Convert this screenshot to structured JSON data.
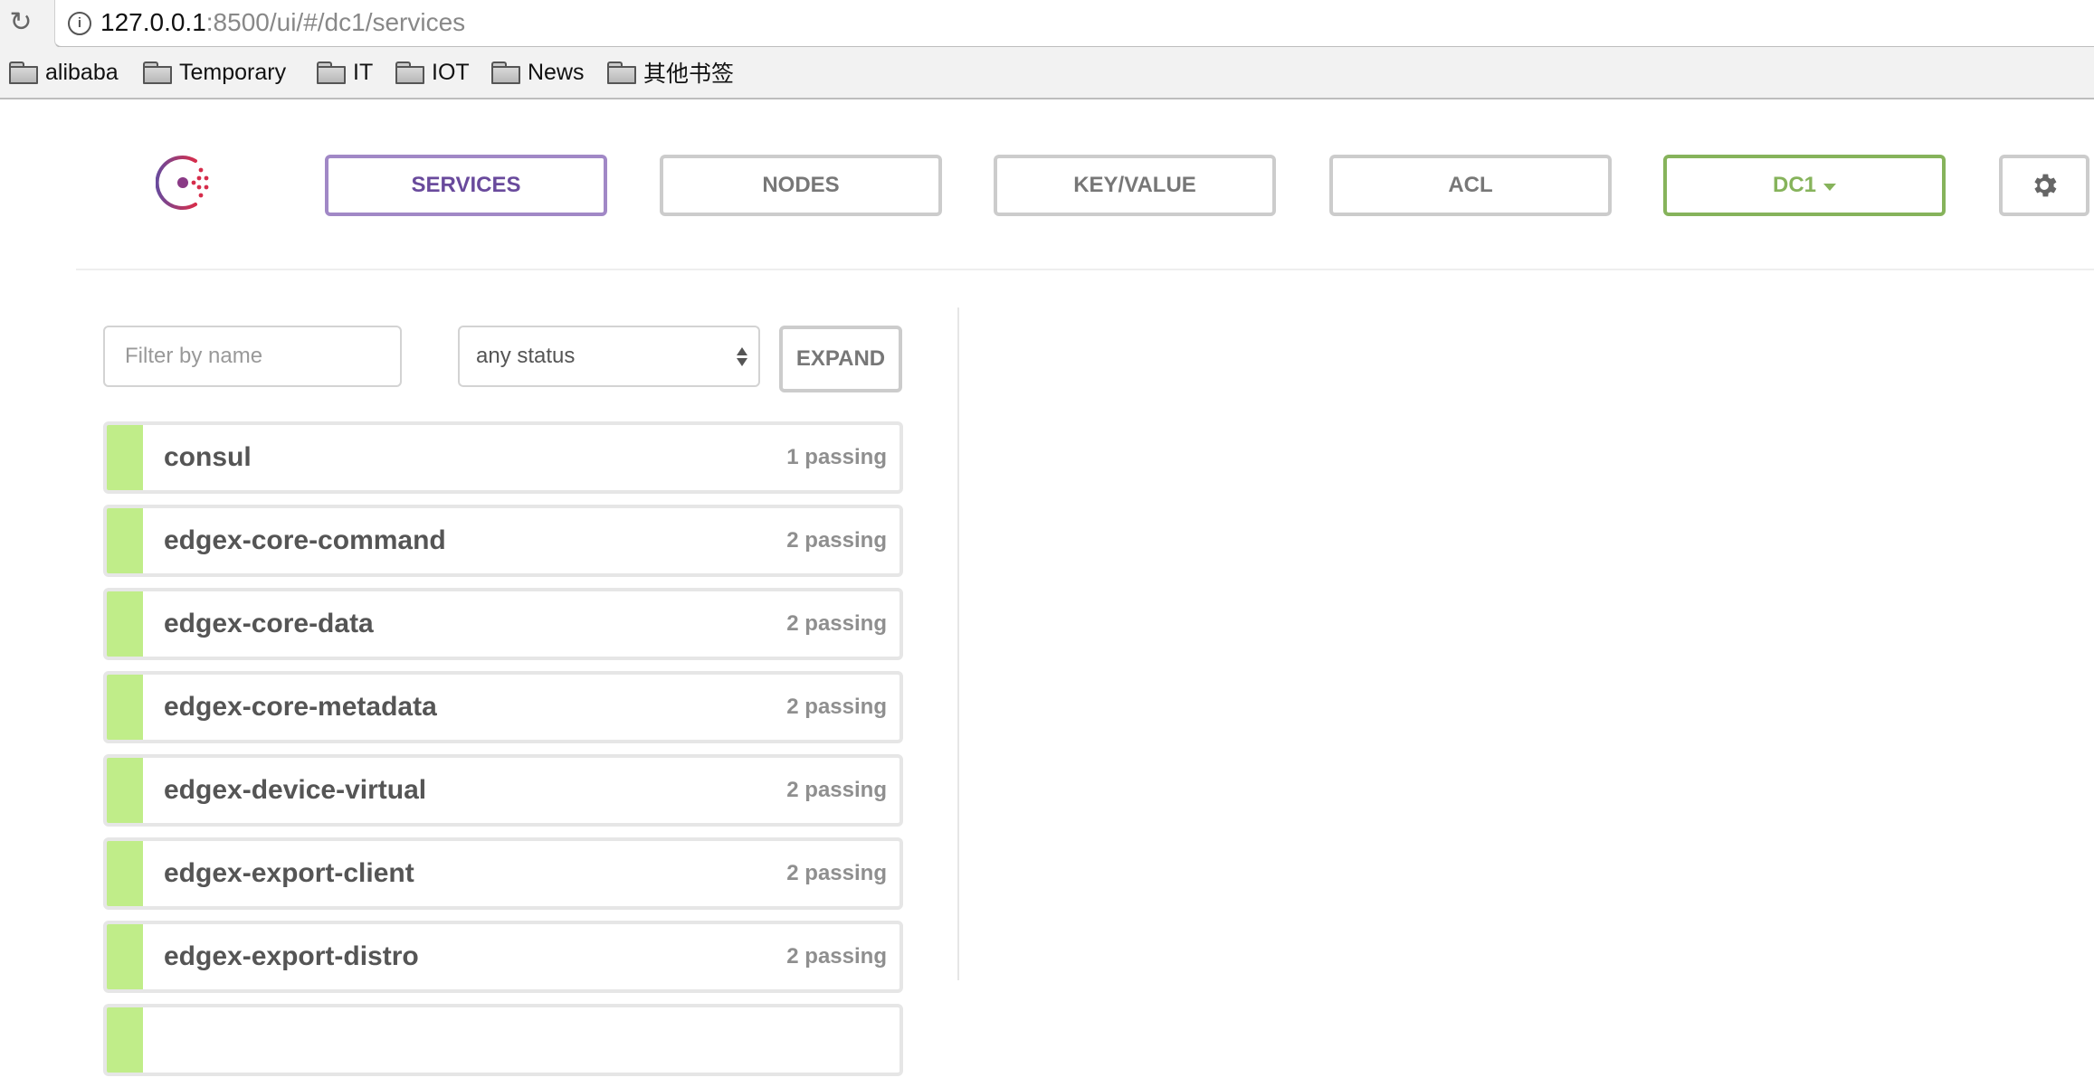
{
  "browser": {
    "url_host": "127.0.0.1",
    "url_rest": ":8500/ui/#/dc1/services",
    "reload_icon": "reload-icon",
    "info_icon": "info-icon",
    "bookmarks": [
      {
        "label": "alibaba",
        "icon": "folder-icon"
      },
      {
        "label": "Temporary",
        "icon": "folder-icon"
      },
      {
        "label": "IT",
        "icon": "folder-icon"
      },
      {
        "label": "IOT",
        "icon": "folder-icon"
      },
      {
        "label": "News",
        "icon": "folder-icon"
      },
      {
        "label": "其他书签",
        "icon": "folder-icon"
      }
    ]
  },
  "nav": {
    "logo": "consul-logo",
    "items": [
      {
        "label": "SERVICES",
        "active": true
      },
      {
        "label": "NODES",
        "active": false
      },
      {
        "label": "KEY/VALUE",
        "active": false
      },
      {
        "label": "ACL",
        "active": false
      }
    ],
    "datacenter": "DC1",
    "settings_icon": "gear-icon"
  },
  "filters": {
    "name_placeholder": "Filter by name",
    "name_value": "",
    "status_value": "any status",
    "expand_label": "EXPAND"
  },
  "colors": {
    "active_nav": "#694a9c",
    "datacenter": "#86b35b",
    "passing": "#c0ed89"
  },
  "services": [
    {
      "name": "consul",
      "status": "1 passing"
    },
    {
      "name": "edgex-core-command",
      "status": "2 passing"
    },
    {
      "name": "edgex-core-data",
      "status": "2 passing"
    },
    {
      "name": "edgex-core-metadata",
      "status": "2 passing"
    },
    {
      "name": "edgex-device-virtual",
      "status": "2 passing"
    },
    {
      "name": "edgex-export-client",
      "status": "2 passing"
    },
    {
      "name": "edgex-export-distro",
      "status": "2 passing"
    },
    {
      "name": "",
      "status": ""
    }
  ]
}
